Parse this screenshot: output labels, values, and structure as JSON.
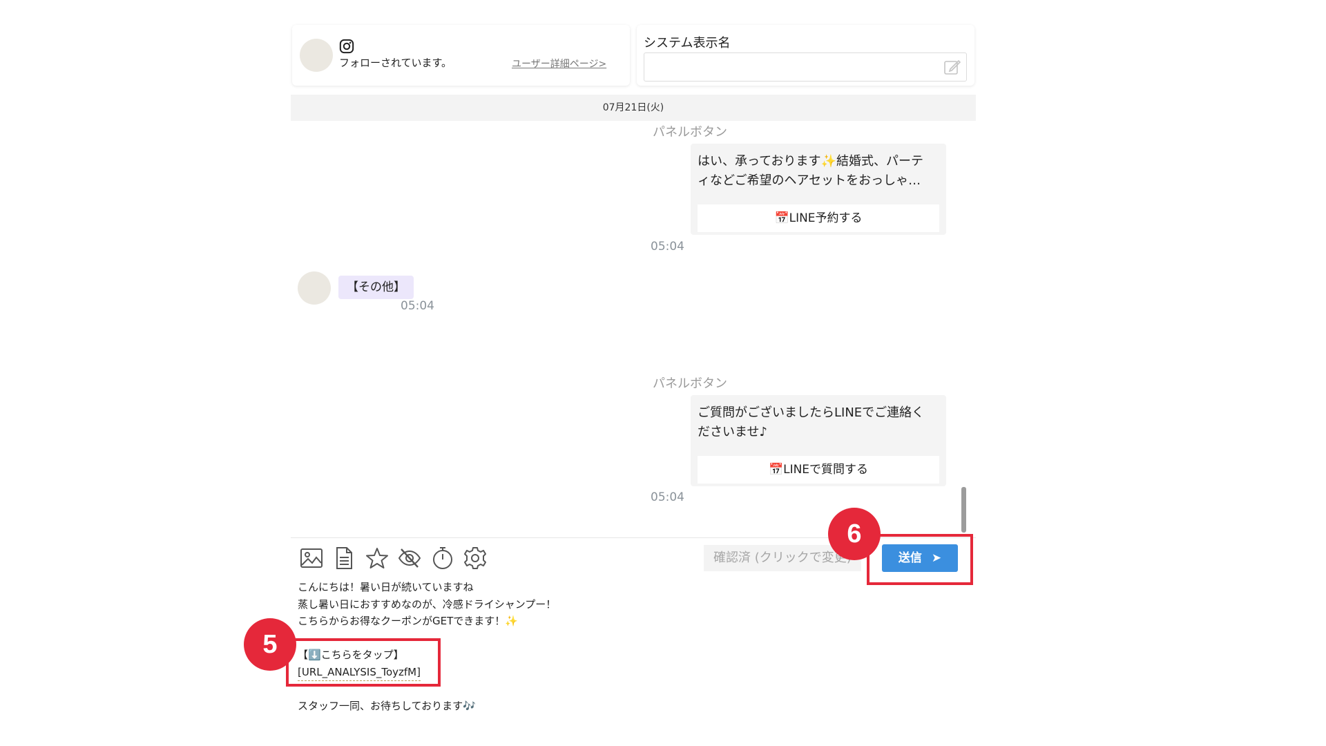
{
  "header": {
    "follow_status": "フォローされています。",
    "detail_link": "ユーザー詳細ページ>",
    "system_name_label": "システム表示名",
    "system_name_value": ""
  },
  "chat": {
    "date": "07月21日(火)",
    "messages": [
      {
        "label": "パネルボタン",
        "line1": "はい、承っております✨結婚式、パーテ",
        "line2": "ィなどご希望のヘアセットをおっしゃ…",
        "button": "📅LINE予約する",
        "time": "05:04"
      },
      {
        "text": "【その他】",
        "time": "05:04"
      },
      {
        "label": "パネルボタン",
        "line1": "ご質問がございましたらLINEでご連絡く",
        "line2": "ださいませ♪",
        "button": "📅LINEで質問する",
        "time": "05:04"
      }
    ]
  },
  "toolbar": {
    "icons": [
      "image-icon",
      "document-icon",
      "star-icon",
      "eye-off-icon",
      "timer-icon",
      "gear-icon"
    ],
    "confirm_label": "確認済 (クリックで変更)",
    "send_label": "送信",
    "send_arrow": "➤"
  },
  "composer": {
    "lines": [
      "こんにちは！暑い日が続いていますね",
      "蒸し暑い日におすすめなのが、冷感ドライシャンプー！",
      "こちらからお得なクーポンがGETできます！✨",
      "",
      "【⬇️こちらをタップ】",
      "[URL_ANALYSIS_ToyzfM]",
      "",
      "スタッフ一同、お待ちしております🎶"
    ]
  },
  "annotations": {
    "badge5": "5",
    "badge6": "6"
  },
  "colors": {
    "accent_red": "#e5283a",
    "send_blue": "#3b8fdf"
  }
}
